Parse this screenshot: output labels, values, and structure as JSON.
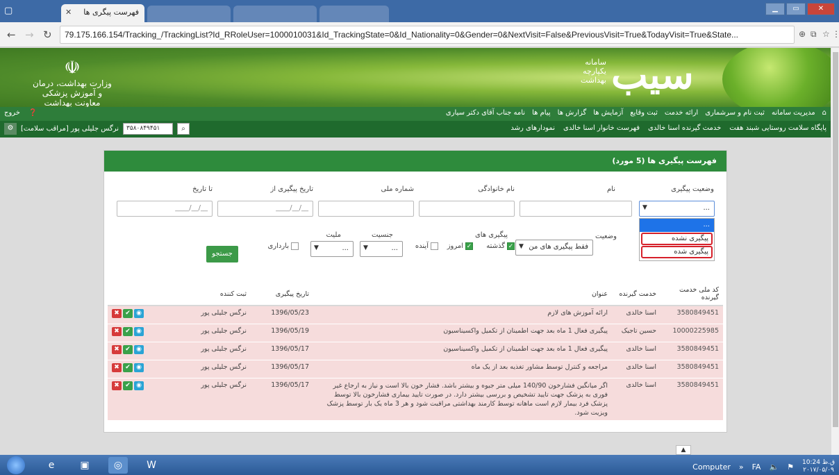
{
  "browser": {
    "tab_title": "فهرست پیگری ها",
    "url": "79.175.166.154/Tracking_/TrackingList?Id_RRoleUser=1000010031&Id_TrackingState=0&Id_Nationality=0&Gender=0&NextVisit=False&PreviousVisit=True&TodayVisit=True&State..."
  },
  "header": {
    "ministry": "وزارت بهداشت، درمان و آموزش پزشکی",
    "ministry_sub": "معاونت بهداشت",
    "brand_line1": "سامانه",
    "brand_line2": "یکپارچه",
    "brand_line3": "بهداشت",
    "logo": "سیب"
  },
  "menu1": {
    "items": [
      "مدیریت سامانه",
      "ثبت نام و سرشماری",
      "ارائه خدمت",
      "ثبت وقایع",
      "آزمایش ها",
      "گزارش ها",
      "پیام ها",
      "نامه جناب آقای دکتر سیاری"
    ],
    "logout": "خروج"
  },
  "menu2": {
    "items": [
      "پایگاه سلامت روستایی شبند هفت",
      "خدمت گیرنده اسنا خالدی",
      "فهرست خانوار اسنا خالدی",
      "نمودارهای رشد"
    ],
    "user_id": "۳۵۸۰۸۴۹۴۵۱",
    "user_name": "نرگس جلیلی پور [مراقب سلامت]"
  },
  "panel": {
    "title": "فهرست پیگیری ها (5 مورد)"
  },
  "filters": {
    "tracking_state_label": "وضعیت پیگیری",
    "tracking_state_value": "...",
    "tracking_state_options": [
      "...",
      "پیگیری نشده",
      "پیگیری شده"
    ],
    "name_label": "نام",
    "family_label": "نام خانوادگی",
    "national_code_label": "شماره ملی",
    "date_from_label": "تاریخ پیگیری از",
    "date_to_label": "تا تاریخ",
    "date_placeholder": "__/__/____",
    "state_label": "وضعیت",
    "state_value": "فقط پیگیری های من",
    "visits_label": "پیگیری های",
    "visit_past": "گذشته",
    "visit_today": "امروز",
    "visit_future": "آینده",
    "gender_label": "جنسیت",
    "gender_value": "...",
    "nationality_label": "ملیت",
    "nationality_value": "...",
    "pregnant_label": "بارداری",
    "search_button": "جستجو"
  },
  "table": {
    "headers": [
      "کد ملی خدمت گیرنده",
      "خدمت گیرنده",
      "عنوان",
      "تاریخ پیگیری",
      "ثبت کننده",
      ""
    ],
    "rows": [
      {
        "code": "3580849451",
        "client": "اسنا خالدی",
        "title": "ارائه آموزش های لازم",
        "date": "1396/05/23",
        "registrar": "نرگس جلیلی پور"
      },
      {
        "code": "10000225985",
        "client": "حسین تاجیک",
        "title": "پیگیری فعال 1 ماه بعد جهت اطمینان از تکمیل واکسیناسیون",
        "date": "1396/05/19",
        "registrar": "نرگس جلیلی پور"
      },
      {
        "code": "3580849451",
        "client": "اسنا خالدی",
        "title": "پیگیری فعال 1 ماه بعد جهت اطمینان از تکمیل واکسیناسیون",
        "date": "1396/05/17",
        "registrar": "نرگس جلیلی پور"
      },
      {
        "code": "3580849451",
        "client": "اسنا خالدی",
        "title": "مراجعه و کنترل توسط مشاور تغذیه بعد از یک ماه",
        "date": "1396/05/17",
        "registrar": "نرگس جلیلی پور"
      },
      {
        "code": "3580849451",
        "client": "اسنا خالدی",
        "title": "اگر میانگین فشارخون 140/90 میلی متر جیوه و بیشتر باشد. فشار خون بالا است و نیاز به ارجاع غیر فوری به پزشک جهت تایید تشخیص و بررسی بیشتر دارد. در صورت تایید بیماری فشارخون بالا توسط پزشک فرد بیمار لازم است ماهانه توسط کارمند بهداشتی مراقبت شود و هر 3 ماه یک بار توسط پزشک ویزیت شود.",
        "date": "1396/05/17",
        "registrar": "نرگس جلیلی پور"
      }
    ]
  },
  "taskbar": {
    "computer": "Computer",
    "lang": "FA",
    "time": "10:24 ق.ظ",
    "date": "۲۰۱۷/۰۵/۰۹"
  },
  "colors": {
    "header_green": "#2e8b3c",
    "row_pink": "#f6dcdc",
    "highlight_blue": "#1e73e8",
    "annotation_red": "#d6202a"
  }
}
